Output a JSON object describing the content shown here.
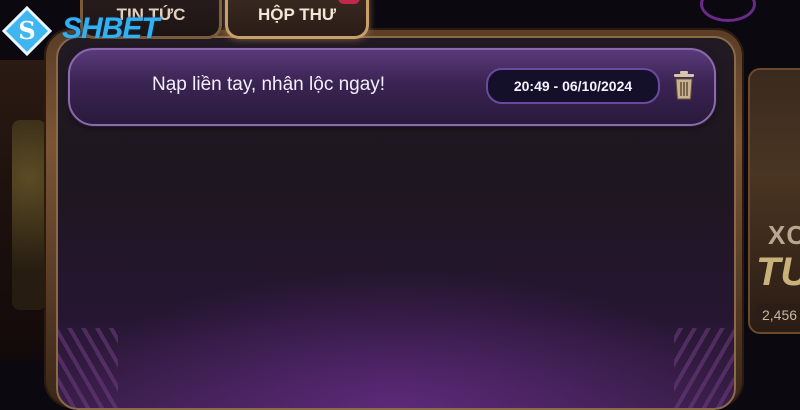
{
  "brand": {
    "logo_text": "SHBET",
    "logo_letter": "S"
  },
  "tabs": [
    {
      "label": "TIN TỨC",
      "active": false
    },
    {
      "label": "HỘP THƯ",
      "active": true
    }
  ],
  "messages": [
    {
      "title": "Nạp liền tay, nhận lộc ngay!",
      "timestamp": "20:49 - 06/10/2024",
      "action_icon": "trash-icon"
    }
  ],
  "background": {
    "side_text_1": "XC",
    "side_text_2": "TU",
    "side_number": "2,456"
  },
  "colors": {
    "accent": "#35b0ee",
    "message_bg": "#3a2452",
    "panel_border": "#8a6a48"
  }
}
